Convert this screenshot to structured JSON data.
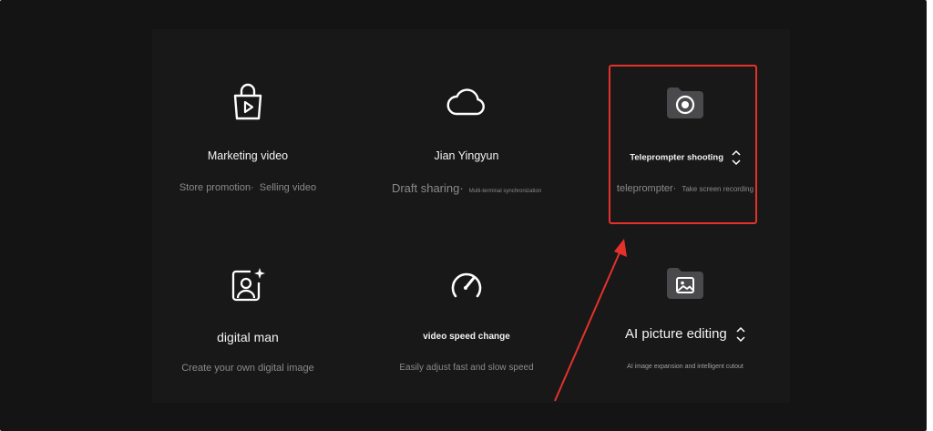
{
  "cards": [
    {
      "title": "Marketing video",
      "subs": [
        "Store promotion·",
        "Selling video"
      ]
    },
    {
      "title": "Jian Yingyun",
      "subs": [
        "Draft sharing·",
        "Multi-terminal synchronization"
      ]
    },
    {
      "title": "Teleprompter shooting",
      "subs": [
        "teleprompter·",
        "Take screen recording"
      ]
    },
    {
      "title": "digital man",
      "subs": [
        "Create your own digital image"
      ]
    },
    {
      "title": "video speed change",
      "subs": [
        "Easily adjust fast and slow speed"
      ]
    },
    {
      "title": "AI picture editing",
      "subs": [
        "AI image expansion and intelligent cutout"
      ]
    }
  ],
  "icons": {
    "c0": "shopping-bag-play-icon",
    "c1": "cloud-icon",
    "c2": "folder-record-icon",
    "c3": "portrait-sparkle-icon",
    "c4": "speedometer-icon",
    "c5": "folder-image-icon",
    "sort": "chevron-up-down-icon"
  },
  "colors": {
    "background": "#141414",
    "highlight": "#e5312b",
    "text": "#f2f2f2",
    "muted": "#8a8a8a",
    "folder": "#4a4a4c"
  }
}
